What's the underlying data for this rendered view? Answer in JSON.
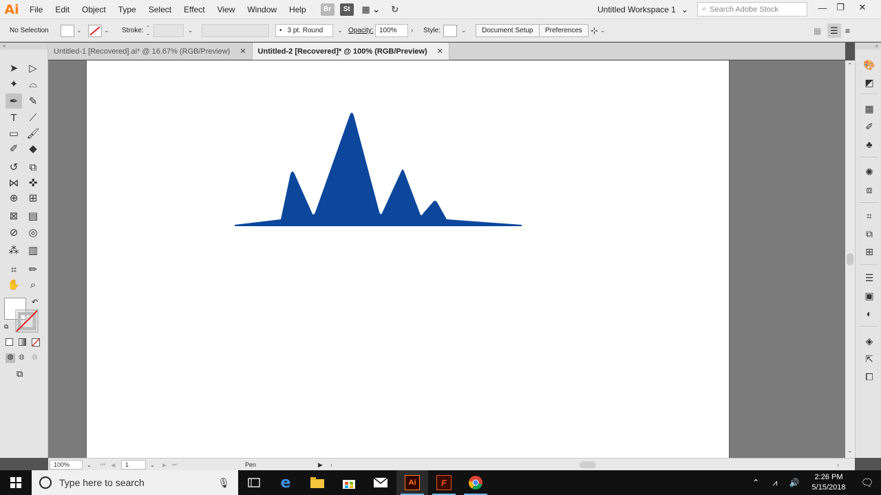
{
  "app": {
    "logo": "Ai",
    "menu": [
      "File",
      "Edit",
      "Object",
      "Type",
      "Select",
      "Effect",
      "View",
      "Window",
      "Help"
    ],
    "bridge_label": "Br",
    "stock_label": "St",
    "workspace": "Untitled Workspace 1",
    "search_placeholder": "Search Adobe Stock"
  },
  "control_bar": {
    "selection": "No Selection",
    "stroke_label": "Stroke:",
    "brush": "3 pt. Round",
    "opacity_label": "Opacity:",
    "opacity_value": "100%",
    "style_label": "Style:",
    "document_setup": "Document Setup",
    "preferences": "Preferences",
    "brush_dot": "•"
  },
  "tabs": [
    {
      "label": "Untitled-1 [Recovered].ai* @ 16.67% (RGB/Preview)",
      "active": false
    },
    {
      "label": "Untitled-2 [Recovered]* @ 100% (RGB/Preview)",
      "active": true
    }
  ],
  "artwork": {
    "fill_color": "#0c479c"
  },
  "status": {
    "zoom": "100%",
    "artboard": "1",
    "tool": "Pen"
  },
  "taskbar": {
    "search_placeholder": "Type here to search",
    "time": "2:26 PM",
    "date": "5/15/2018"
  },
  "colors": {
    "illustrator_orange": "#ff7f18",
    "taskbar_bg": "#111111"
  }
}
